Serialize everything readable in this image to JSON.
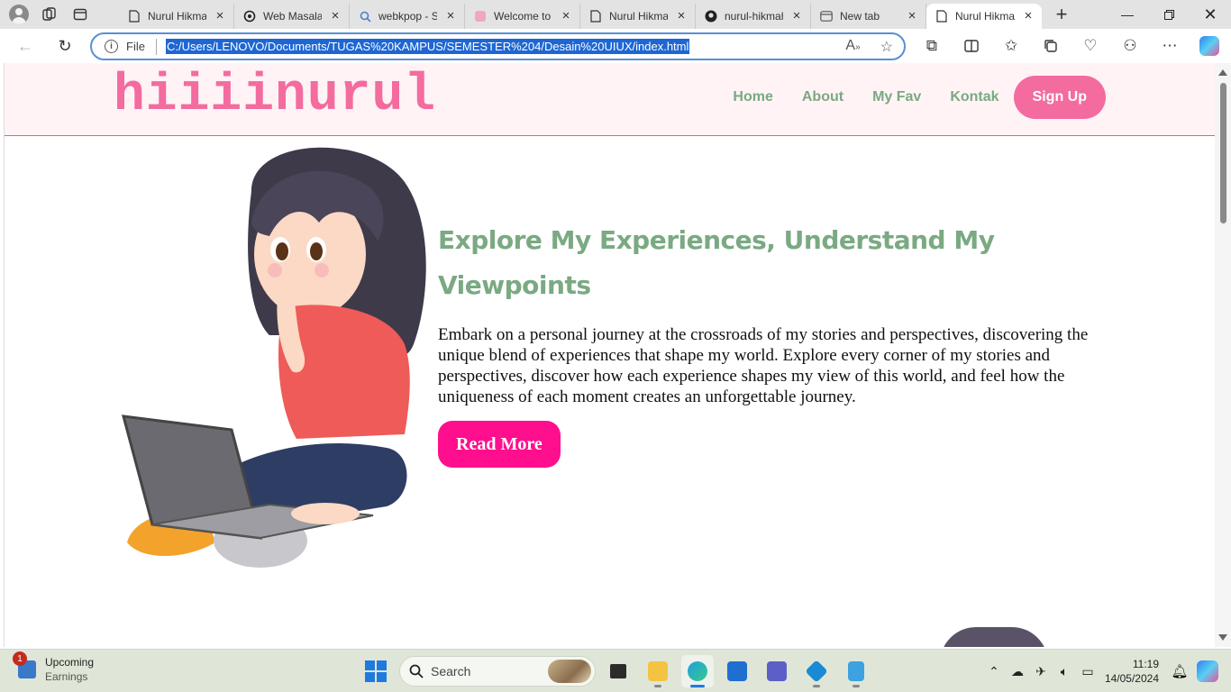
{
  "browser": {
    "tabs": [
      {
        "title": "Nurul Hikmah",
        "icon": "page-icon"
      },
      {
        "title": "Web Masalah",
        "icon": "openai-icon"
      },
      {
        "title": "webkpop - Search",
        "icon": "search-icon"
      },
      {
        "title": "Welcome to",
        "icon": "app-icon"
      },
      {
        "title": "Nurul Hikmah",
        "icon": "page-icon"
      },
      {
        "title": "nurul-hikmah",
        "icon": "github-icon"
      },
      {
        "title": "New tab",
        "icon": "newtab-icon"
      },
      {
        "title": "Nurul Hikmah",
        "icon": "page-icon",
        "active": true
      }
    ],
    "address": {
      "scheme_label": "File",
      "url": "C:/Users/LENOVO/Documents/TUGAS%20KAMPUS/SEMESTER%204/Desain%20UIUX/index.html"
    }
  },
  "site": {
    "logo": "hiiiinurul",
    "nav": {
      "home": "Home",
      "about": "About",
      "fav": "My Fav",
      "contact": "Kontak",
      "signup": "Sign Up"
    },
    "hero": {
      "title": "Explore My Experiences, Understand My Viewpoints",
      "description": "Embark on a personal journey at the crossroads of my stories and perspectives, discovering the unique blend of experiences that shape my world. Explore every corner of my stories and perspectives, discover how each experience shapes my view of this world, and feel how the uniqueness of each moment creates an unforgettable journey.",
      "button": "Read More"
    }
  },
  "colors": {
    "accent_pink": "#f36b9f",
    "button_pink": "#ff0f8e",
    "nav_green": "#7aa982",
    "header_bg": "#fff3f5"
  },
  "taskbar": {
    "widget_title": "Upcoming",
    "widget_sub": "Earnings",
    "widget_badge": "1",
    "search_placeholder": "Search",
    "time": "11:19",
    "date": "14/05/2024"
  }
}
